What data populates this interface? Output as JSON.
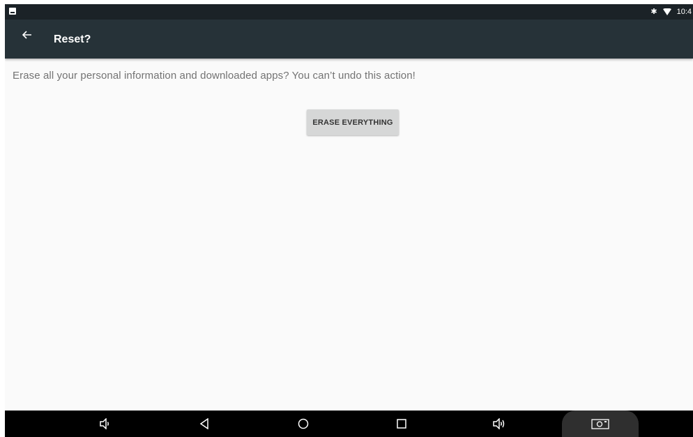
{
  "status_bar": {
    "time": "10:4",
    "icons": [
      "notification-icon",
      "bluetooth-icon",
      "wifi-icon"
    ]
  },
  "app_bar": {
    "title": "Reset?",
    "back_icon": "arrow-back-icon",
    "background": "#263238"
  },
  "content": {
    "message": "Erase all your personal information and downloaded apps? You can’t undo this action!",
    "erase_button_label": "ERASE EVERYTHING"
  },
  "nav_bar": {
    "buttons": [
      "volume-down-icon",
      "back-icon",
      "home-icon",
      "recents-icon",
      "volume-up-icon",
      "screenshot-icon"
    ]
  }
}
